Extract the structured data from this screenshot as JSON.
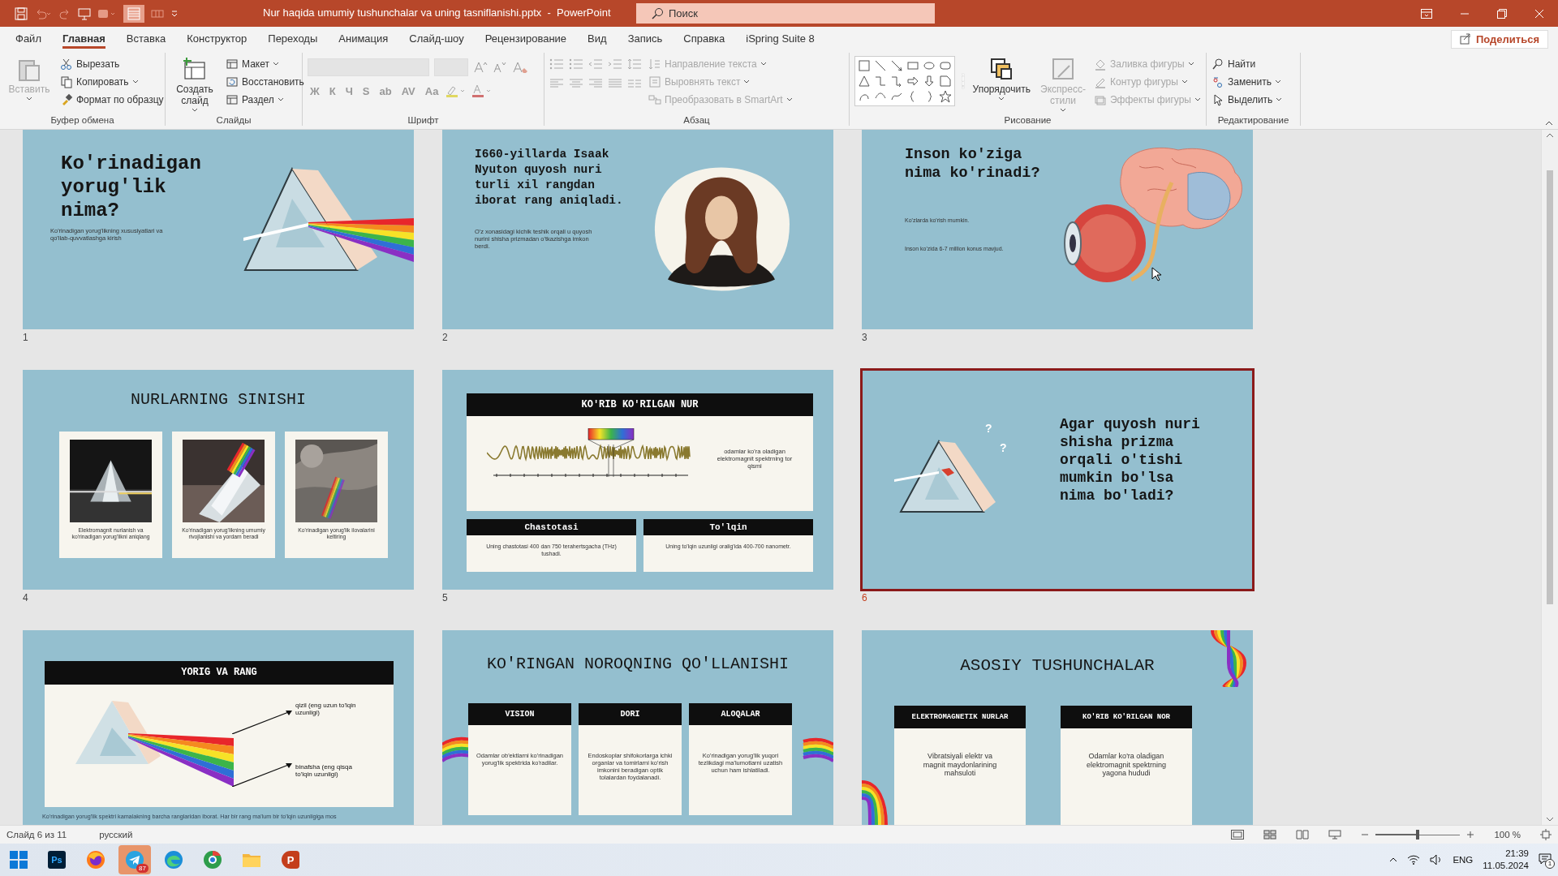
{
  "title_bar": {
    "title": "Nur haqida umumiy tushunchalar va uning tasniflanishi.pptx  -  PowerPoint",
    "search_placeholder": "Поиск"
  },
  "menu_tabs": [
    {
      "label": "Файл",
      "selected": false
    },
    {
      "label": "Главная",
      "selected": true
    },
    {
      "label": "Вставка",
      "selected": false
    },
    {
      "label": "Конструктор",
      "selected": false
    },
    {
      "label": "Переходы",
      "selected": false
    },
    {
      "label": "Анимация",
      "selected": false
    },
    {
      "label": "Слайд-шоу",
      "selected": false
    },
    {
      "label": "Рецензирование",
      "selected": false
    },
    {
      "label": "Вид",
      "selected": false
    },
    {
      "label": "Запись",
      "selected": false
    },
    {
      "label": "Справка",
      "selected": false
    },
    {
      "label": "iSpring Suite 8",
      "selected": false
    }
  ],
  "share_button": "Поделиться",
  "ribbon_groups": [
    {
      "name": "Буфер обмена",
      "kind": "buttons",
      "large_items": [
        {
          "kind": "paste",
          "label": "Вставить",
          "disabled": true,
          "dropdown": true
        }
      ],
      "small_items": [
        {
          "kind": "scissors",
          "label": "Вырезать",
          "disabled": false,
          "dropdown": false
        },
        {
          "kind": "copy",
          "label": "Копировать",
          "disabled": false,
          "dropdown": true
        },
        {
          "kind": "brush",
          "label": "Формат по образцу",
          "disabled": false,
          "dropdown": false
        }
      ]
    },
    {
      "name": "Слайды",
      "kind": "buttons",
      "large_items": [
        {
          "kind": "new-slide",
          "label": "Создать слайд",
          "disabled": false,
          "dropdown": true
        }
      ],
      "small_items": [
        {
          "kind": "layout",
          "label": "Макет",
          "disabled": false,
          "dropdown": true
        },
        {
          "kind": "reset",
          "label": "Восстановить",
          "disabled": false,
          "dropdown": false
        },
        {
          "kind": "section",
          "label": "Раздел",
          "disabled": false,
          "dropdown": true
        }
      ]
    },
    {
      "name": "Шрифт",
      "kind": "font",
      "font_buttons": [
        "Ж",
        "К",
        "Ч",
        "S",
        "ab",
        "AV",
        "Aa"
      ]
    },
    {
      "name": "Абзац",
      "kind": "paragraph",
      "small_items": [
        {
          "kind": "text-direction",
          "label": "Направление текста",
          "disabled": true,
          "dropdown": true
        },
        {
          "kind": "align-text",
          "label": "Выровнять текст",
          "disabled": true,
          "dropdown": true
        },
        {
          "kind": "smartart",
          "label": "Преобразовать в SmartArt",
          "disabled": true,
          "dropdown": true
        }
      ]
    },
    {
      "name": "Рисование",
      "kind": "drawing",
      "large_items": [
        {
          "kind": "arrange",
          "label": "Упорядочить",
          "disabled": false,
          "dropdown": true
        },
        {
          "kind": "styles",
          "label": "Экспресс-стили",
          "disabled": true,
          "dropdown": true
        }
      ],
      "small_items": [
        {
          "kind": "fill",
          "label": "Заливка фигуры",
          "disabled": true,
          "dropdown": true
        },
        {
          "kind": "outline",
          "label": "Контур фигуры",
          "disabled": true,
          "dropdown": true
        },
        {
          "kind": "effects",
          "label": "Эффекты фигуры",
          "disabled": true,
          "dropdown": true
        }
      ]
    },
    {
      "name": "Редактирование",
      "kind": "buttons",
      "small_items": [
        {
          "kind": "search",
          "label": "Найти",
          "disabled": false,
          "dropdown": false
        },
        {
          "kind": "replace",
          "label": "Заменить",
          "disabled": false,
          "dropdown": true
        },
        {
          "kind": "select",
          "label": "Выделить",
          "disabled": false,
          "dropdown": true
        }
      ]
    }
  ],
  "slides": [
    {
      "number": "1",
      "selected": false,
      "kind": "title_picture",
      "title": "Ko'rinadigan yorug'lik nima?",
      "body": "Ko'rinadigan yorug'likning xususiyatlari va qo'llab-quvvatlashga kirish"
    },
    {
      "number": "2",
      "selected": false,
      "kind": "portrait",
      "title": "I660-yillarda Isaak Nyuton quyosh nuri turli xil rangdan iborat rang aniqladi.",
      "body": "O'z xonasidagi kichik teshik orqali u quyosh nurini shisha prizmadan o'tkazishga imkon berdi."
    },
    {
      "number": "3",
      "selected": false,
      "kind": "eye",
      "title": "Inson ko'ziga nima ko'rinadi?",
      "notes": [
        "Ko'zlarda ko'rish mumkin.",
        "Inson ko'zida 6-7 million konus mavjud."
      ]
    },
    {
      "number": "4",
      "selected": false,
      "kind": "cards",
      "title": "NURLARNING SINISHI",
      "cards": [
        {
          "caption": "Elektromagnit nurlanish va ko'rinadigan yorug'likni aniqlang"
        },
        {
          "caption": "Ko'rinadigan yorug'likning umumiy rivojlanishi va yordam beradi"
        },
        {
          "caption": "Ko'rinadigan yorug'lik ilovalarini keltiring"
        }
      ]
    },
    {
      "number": "5",
      "selected": false,
      "kind": "spectrum",
      "header": "KO'RIB KO'RILGAN NUR",
      "side_text": "odamlar ko'ra oladigan elektromagnit spektrning tor qismi",
      "boxes": [
        {
          "heading": "Chastotasi",
          "text": "Uning chastotasi 400 dan 750 terahertsgacha (THz) tushadi."
        },
        {
          "heading": "To'lqin",
          "text": "Uning to'lqin uzunligi oralig'ida 400-700 nanometr."
        }
      ]
    },
    {
      "number": "6",
      "selected": true,
      "kind": "question",
      "marks": [
        "?",
        "?"
      ],
      "text": "Agar quyosh nuri shisha prizma orqali o'tishi mumkin bo'lsa nima bo'ladi?"
    },
    {
      "selected": false,
      "kind": "dispersion",
      "header": "YORIG VA RANG",
      "labels": [
        "qizil (eng uzun to'lqin uzunligi)",
        "binafsha (eng qisqa to'lqin uzunligi)"
      ],
      "caption": "Ko'rinadigan yorug'lik spektri kamalakning barcha ranglaridan iborat. Har bir rang ma'lum bir to'lqin uzunligiga mos"
    },
    {
      "selected": false,
      "kind": "columns",
      "title": "KO'RINGAN NOROQNING QO'LLANISHI",
      "columns": [
        {
          "heading": "VISION",
          "text": "Odamlar ob'ektlarni ko'rinadigan yorug'lik spektrida ko'radilar."
        },
        {
          "heading": "DORI",
          "text": "Endoskoplar shifokorlarga ichki organlar va tomirlarni ko'rish imkonini beradigan optik tolalardan foydalanadi."
        },
        {
          "heading": "ALOQALAR",
          "text": "Ko'rinadigan yorug'lik yuqori tezlikdagi ma'lumotlarni uzatish uchun ham ishlatiladi."
        }
      ]
    },
    {
      "selected": false,
      "kind": "concepts",
      "title": "ASOSIY TUSHUNCHALAR",
      "columns": [
        {
          "heading": "ELEKTROMAGNETIK NURLAR",
          "text": "Vibratsiyali elektr va magnit maydonlarining mahsuloti"
        },
        {
          "heading": "KO'RIB KO'RILGAN NOR",
          "text": "Odamlar ko'ra oladigan elektromagnit spektrning yagona hududi"
        }
      ]
    }
  ],
  "status_bar": {
    "slide_info": "Слайд 6 из 11",
    "language": "русский",
    "zoom": "100 %",
    "zoom_slider": {
      "level": 0.5
    }
  },
  "taskbar": {
    "apps": [
      {
        "kind": "photoshop",
        "label": "Ps",
        "selected": false
      },
      {
        "kind": "firefox",
        "selected": false
      },
      {
        "kind": "telegram",
        "badge": "87",
        "selected": true
      },
      {
        "kind": "edge",
        "selected": false
      },
      {
        "kind": "chrome",
        "selected": false
      },
      {
        "kind": "folder",
        "selected": false
      },
      {
        "kind": "powerpoint",
        "label": "P",
        "selected": false
      }
    ],
    "language": "ENG",
    "time": "21:39",
    "date": "11.05.2024",
    "notifications": "1"
  }
}
